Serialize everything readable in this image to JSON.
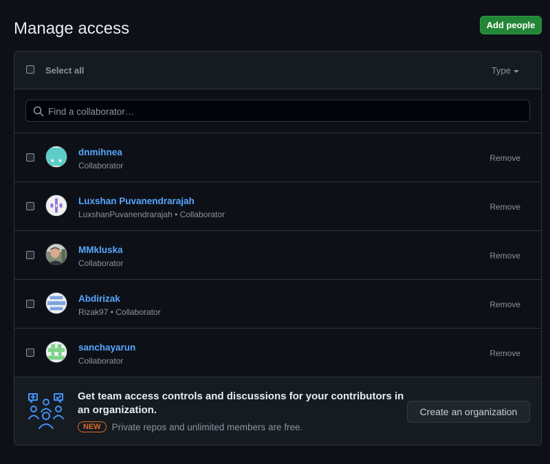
{
  "page": {
    "title": "Manage access",
    "add_people_label": "Add people"
  },
  "list_header": {
    "select_all_label": "Select all",
    "type_filter_label": "Type"
  },
  "search": {
    "placeholder": "Find a collaborator…",
    "value": ""
  },
  "collaborators": [
    {
      "name": "dnmihnea",
      "subtitle": "Collaborator",
      "remove_label": "Remove",
      "avatar": "identicon-teal"
    },
    {
      "name": "Luxshan Puvanendrarajah",
      "subtitle": "LuxshanPuvanendrarajah • Collaborator",
      "remove_label": "Remove",
      "avatar": "identicon-purple"
    },
    {
      "name": "MMkluska",
      "subtitle": "Collaborator",
      "remove_label": "Remove",
      "avatar": "photo"
    },
    {
      "name": "Abdirizak",
      "subtitle": "Rizak97 • Collaborator",
      "remove_label": "Remove",
      "avatar": "identicon-blue"
    },
    {
      "name": "sanchayarun",
      "subtitle": "Collaborator",
      "remove_label": "Remove",
      "avatar": "identicon-green"
    }
  ],
  "promo": {
    "title": "Get team access controls and discussions for your contributors in an organization.",
    "badge": "NEW",
    "text": "Private repos and unlimited members are free.",
    "button_label": "Create an organization",
    "icon": "people-discussion-icon"
  },
  "colors": {
    "background": "#0d1117",
    "primary_button": "#238636",
    "link": "#58a6ff",
    "new_badge": "#db6d28"
  }
}
